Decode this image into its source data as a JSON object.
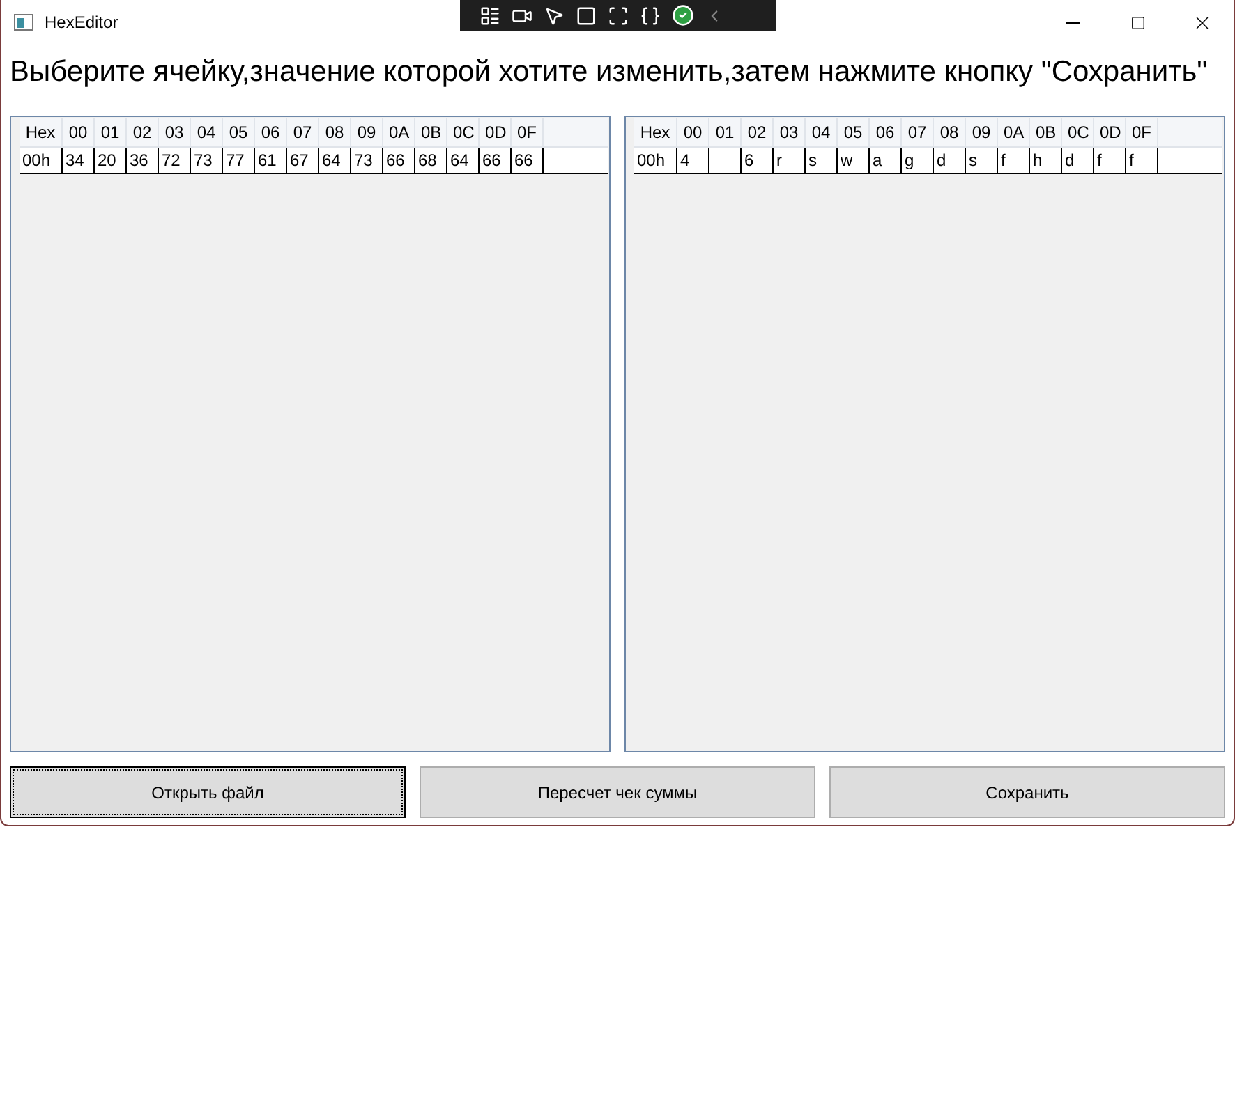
{
  "window": {
    "title": "HexEditor"
  },
  "instruction": "Выберите ячейку,значение которой хотите изменить,затем нажмите кнопку \"Сохранить\"",
  "grids": [
    {
      "columns": [
        "Hex",
        "00",
        "01",
        "02",
        "03",
        "04",
        "05",
        "06",
        "07",
        "08",
        "09",
        "0A",
        "0B",
        "0C",
        "0D",
        "0F"
      ],
      "rows": [
        {
          "cells": [
            "00h",
            "34",
            "20",
            "36",
            "72",
            "73",
            "77",
            "61",
            "67",
            "64",
            "73",
            "66",
            "68",
            "64",
            "66",
            "66"
          ]
        }
      ]
    },
    {
      "columns": [
        "Hex",
        "00",
        "01",
        "02",
        "03",
        "04",
        "05",
        "06",
        "07",
        "08",
        "09",
        "0A",
        "0B",
        "0C",
        "0D",
        "0F"
      ],
      "rows": [
        {
          "cells": [
            "00h",
            "4",
            "",
            "6",
            "r",
            "s",
            "w",
            "a",
            "g",
            "d",
            "s",
            "f",
            "h",
            "d",
            "f",
            "f"
          ]
        }
      ]
    }
  ],
  "buttons": [
    {
      "label": "Открыть файл",
      "focused": true
    },
    {
      "label": "Пересчет чек суммы",
      "focused": false
    },
    {
      "label": "Сохранить",
      "focused": false
    }
  ]
}
